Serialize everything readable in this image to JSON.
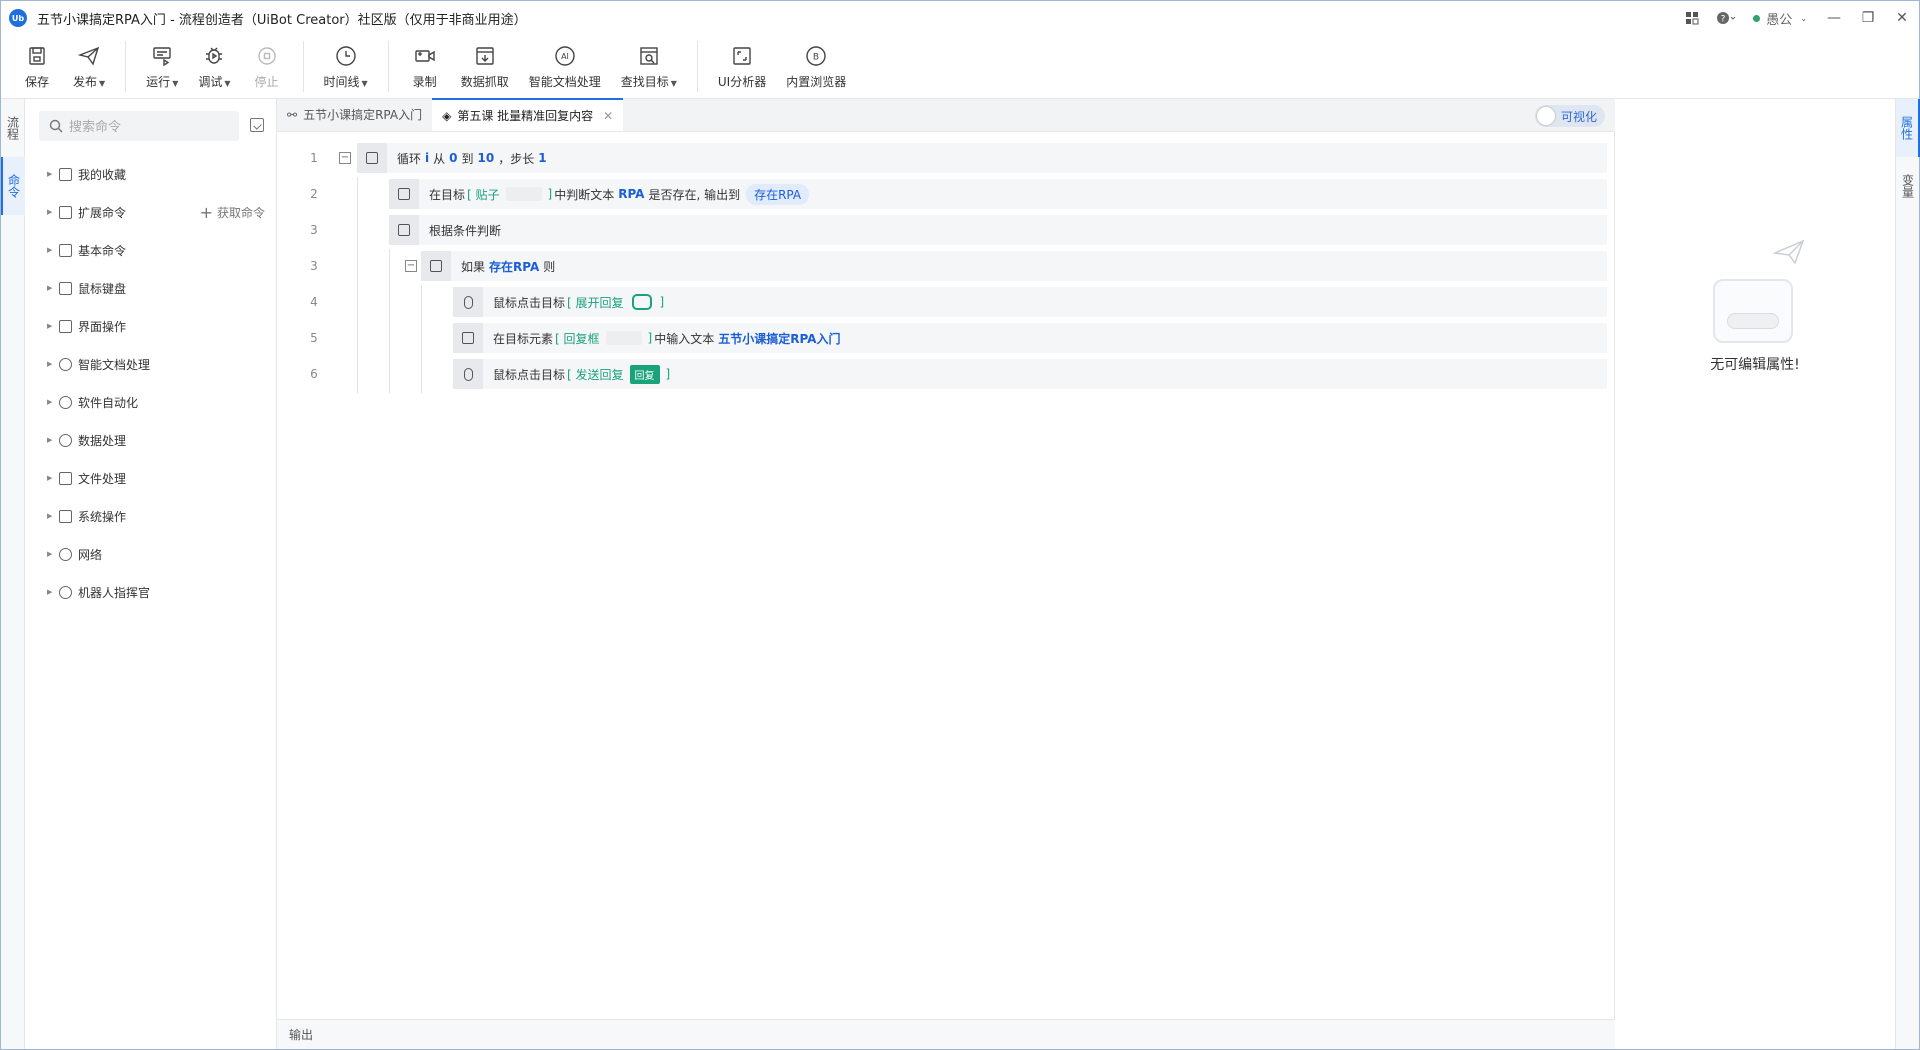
{
  "window": {
    "title": "五节小课搞定RPA入门 - 流程创造者（UiBot Creator）社区版（仅用于非商业用途）",
    "logo": "Ub",
    "user": "愚公"
  },
  "toolbar": {
    "save": "保存",
    "publish": "发布",
    "run": "运行",
    "debug": "调试",
    "stop": "停止",
    "timeline": "时间线",
    "record": "录制",
    "data_scrape": "数据抓取",
    "smart_doc": "智能文档处理",
    "find_target": "查找目标",
    "ui_analyzer": "UI分析器",
    "browser": "内置浏览器"
  },
  "left_rail": {
    "flow": "流程",
    "command": "命令"
  },
  "right_rail": {
    "props": "属性",
    "vars": "变量"
  },
  "command_panel": {
    "search_placeholder": "搜索命令",
    "get_command": "获取命令",
    "items": [
      {
        "label": "我的收藏"
      },
      {
        "label": "扩展命令"
      },
      {
        "label": "基本命令"
      },
      {
        "label": "鼠标键盘"
      },
      {
        "label": "界面操作"
      },
      {
        "label": "智能文档处理"
      },
      {
        "label": "软件自动化"
      },
      {
        "label": "数据处理"
      },
      {
        "label": "文件处理"
      },
      {
        "label": "系统操作"
      },
      {
        "label": "网络"
      },
      {
        "label": "机器人指挥官"
      }
    ]
  },
  "editor": {
    "tabs": [
      {
        "label": "五节小课搞定RPA入门"
      },
      {
        "label": "第五课 批量精准回复内容"
      }
    ],
    "visualize": "可视化",
    "rows": {
      "r1": {
        "num": "1",
        "t1": "循环",
        "v1": "i",
        "t2": "从",
        "v2": "0",
        "t3": "到",
        "v3": "10",
        "t4": "，步长",
        "v4": "1"
      },
      "r2": {
        "num": "2",
        "t1": "在目标",
        "target": "[ 贴子",
        "target_end": "]",
        "t2": "中判断文本",
        "v1": "RPA",
        "t3": "是否存在, 输出到",
        "var": "存在RPA"
      },
      "r3": {
        "num": "3",
        "t1": "根据条件判断"
      },
      "r4": {
        "num": "3",
        "t1": "如果",
        "var": "存在RPA",
        "t2": "则"
      },
      "r5": {
        "num": "4",
        "t1": "鼠标点击目标",
        "target": "[ 展开回复",
        "target_end": "]"
      },
      "r6": {
        "num": "5",
        "t1": "在目标元素",
        "target": "[ 回复框",
        "target_end": "]",
        "t2": "中输入文本",
        "v1": "五节小课搞定RPA入门"
      },
      "r7": {
        "num": "6",
        "t1": "鼠标点击目标",
        "target": "[ 发送回复",
        "btn": "回复",
        "target_end": "]"
      }
    },
    "output_label": "输出"
  },
  "properties": {
    "empty_text": "无可编辑属性!"
  },
  "colors": {
    "accent": "#1f6fe0",
    "keyword": "#1a5ed8",
    "target": "#1aa37a"
  }
}
